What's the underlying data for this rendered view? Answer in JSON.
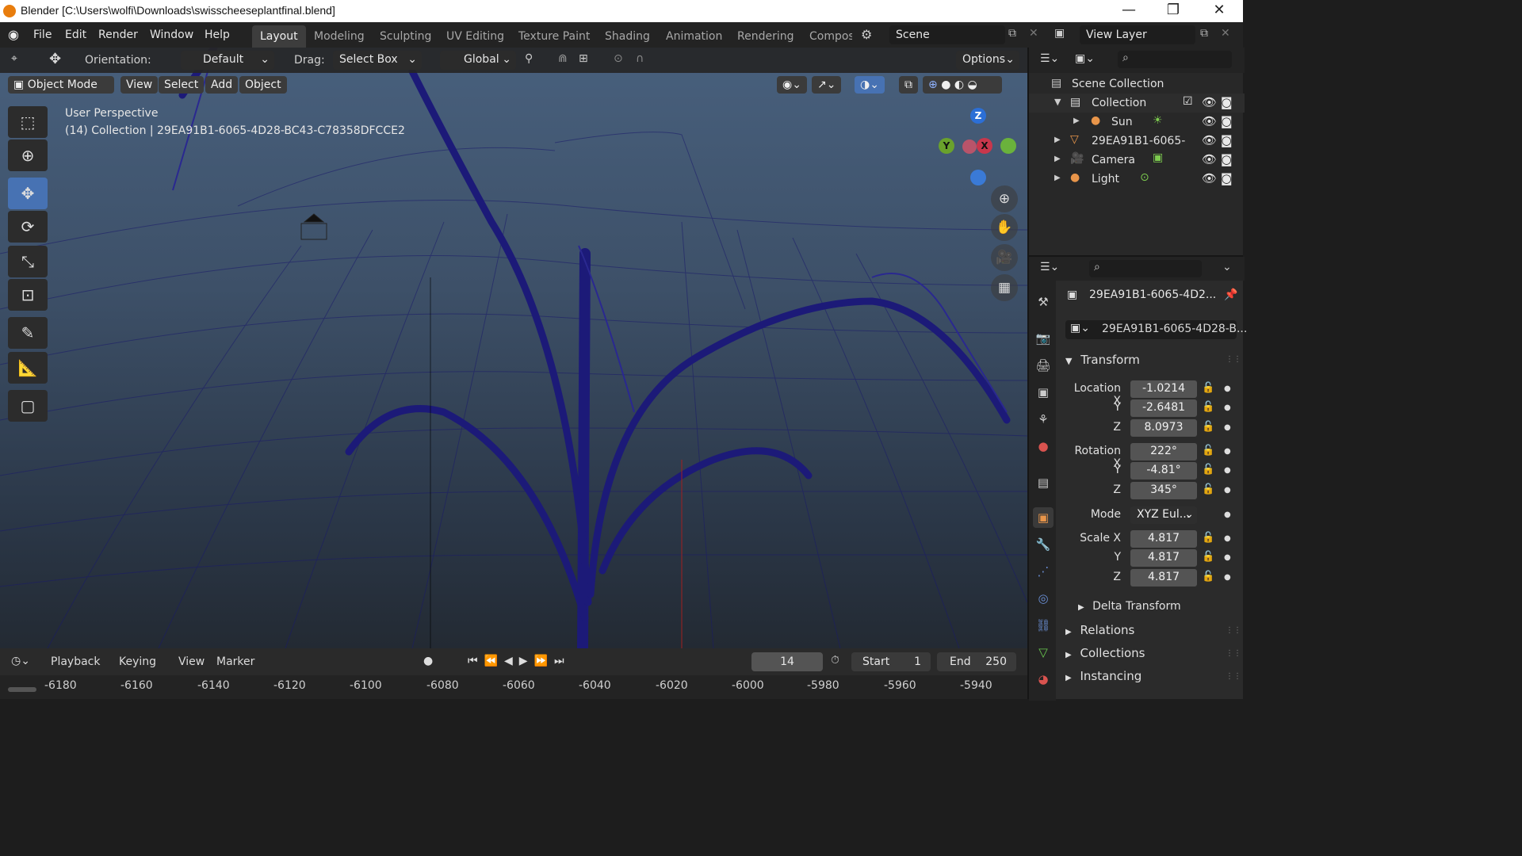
{
  "window": {
    "title": "Blender [C:\\Users\\wolfi\\Downloads\\swisscheeseplantfinal.blend]",
    "minimize": "—",
    "maximize": "❐",
    "close": "✕"
  },
  "menu": {
    "items": [
      "File",
      "Edit",
      "Render",
      "Window",
      "Help"
    ],
    "workspaces": [
      "Layout",
      "Modeling",
      "Sculpting",
      "UV Editing",
      "Texture Paint",
      "Shading",
      "Animation",
      "Rendering",
      "Compos"
    ],
    "active_workspace": "Layout",
    "scene": "Scene",
    "view_layer": "View Layer"
  },
  "tool_header": {
    "orientation_label": "Orientation:",
    "orientation_value": "Default",
    "drag_label": "Drag:",
    "drag_value": "Select Box",
    "transform_orientation": "Global",
    "options_label": "Options"
  },
  "viewport_header": {
    "mode": "Object Mode",
    "menus": [
      "View",
      "Select",
      "Add",
      "Object"
    ]
  },
  "viewport": {
    "perspective": "User Perspective",
    "info": "(14) Collection | 29EA91B1-6065-4D28-BC43-C78358DFCCE2",
    "gizmo": {
      "z": "Z",
      "y": "Y",
      "x": "X"
    }
  },
  "timeline": {
    "menus": [
      "Playback",
      "Keying",
      "View",
      "Marker"
    ],
    "current_frame": "14",
    "start_label": "Start",
    "start_value": "1",
    "end_label": "End",
    "end_value": "250",
    "ruler": [
      "-6180",
      "-6160",
      "-6140",
      "-6120",
      "-6100",
      "-6080",
      "-6060",
      "-6040",
      "-6020",
      "-6000",
      "-5980",
      "-5960",
      "-5940"
    ]
  },
  "outliner": {
    "root": "Scene Collection",
    "items": [
      {
        "name": "Collection"
      },
      {
        "name": "Sun"
      },
      {
        "name": "29EA91B1-6065-"
      },
      {
        "name": "Camera"
      },
      {
        "name": "Light"
      }
    ]
  },
  "properties": {
    "object_name": "29EA91B1-6065-4D2...",
    "data_name": "29EA91B1-6065-4D28-B...",
    "transform_title": "Transform",
    "location": {
      "label": "Location X",
      "x": "-1.0214",
      "y": "-2.6481",
      "z": "8.0973"
    },
    "rotation": {
      "label": "Rotation X",
      "x": "222°",
      "y": "-4.81°",
      "z": "345°"
    },
    "mode_label": "Mode",
    "mode_value": "XYZ Eul...",
    "scale": {
      "label": "Scale X",
      "x": "4.817",
      "y": "4.817",
      "z": "4.817"
    },
    "axis_y": "Y",
    "axis_z": "Z",
    "sections": [
      "Delta Transform",
      "Relations",
      "Collections",
      "Instancing"
    ]
  },
  "colors": {
    "accent": "#4772b3",
    "wireframe": "#1c1a6e",
    "viewport_top": "#48607d",
    "viewport_bottom": "#232a33"
  }
}
